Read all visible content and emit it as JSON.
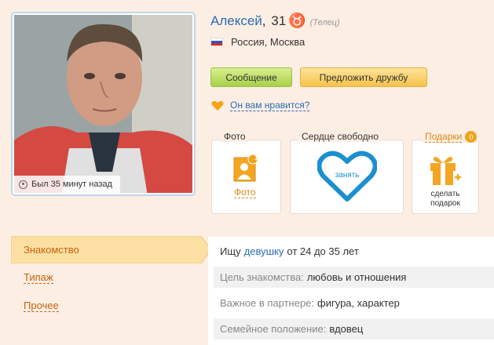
{
  "profile": {
    "name": "Алексей",
    "age": "31",
    "zodiac_symbol": "♉",
    "zodiac_name": "(Телец)",
    "location": "Россия, Москва",
    "last_seen": "Был 35 минут назад"
  },
  "actions": {
    "message_label": "Сообщение",
    "friend_label": "Предложить дружбу",
    "like_question": "Он вам нравится?"
  },
  "boxes": {
    "photo_title": "Фото",
    "photo_badge": "1",
    "photo_link": "Фото",
    "heart_title": "Сердце свободно",
    "heart_text": "занять",
    "gifts_title": "Подарки",
    "gifts_badge": "0",
    "gift_text_1": "сделать",
    "gift_text_2": "подарок"
  },
  "tabs": {
    "active": "Знакомство",
    "type": "Типаж",
    "other": "Прочее"
  },
  "info": {
    "seek_prefix": "Ищу",
    "seek_link": "девушку",
    "seek_suffix": "от 24 до 35 лет",
    "goal_label": "Цель знакомства:",
    "goal_value": "любовь и отношения",
    "important_label": "Важное в партнере:",
    "important_value": "фигура, характер",
    "family_label": "Семейное положение:",
    "family_value": "вдовец"
  },
  "colors": {
    "background": "#fdeee4",
    "link_blue": "#2a6bb4",
    "link_orange": "#c8620a",
    "message_button": "#a8d04b",
    "friend_button": "#f5c24b",
    "heart_blue": "#1b8fcf"
  },
  "icons": {
    "clock": "clock-icon",
    "flag": "russia-flag-icon",
    "like": "heart-icon",
    "photo": "photo-album-icon",
    "heart": "heart-outline-icon",
    "gift": "gift-icon"
  }
}
